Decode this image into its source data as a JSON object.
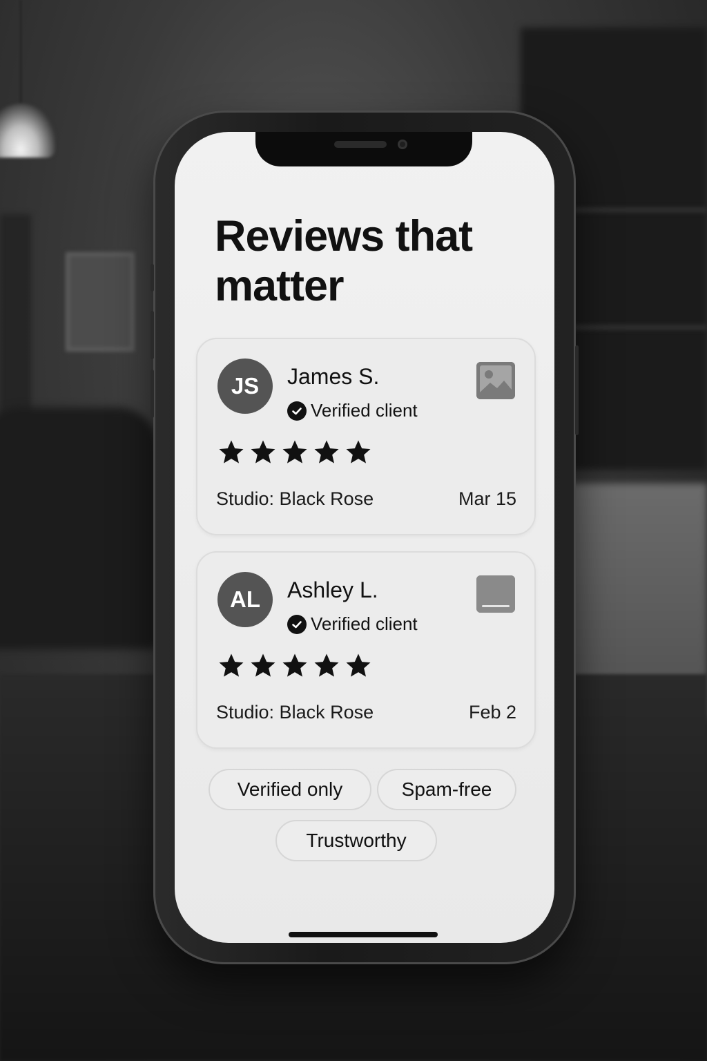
{
  "page": {
    "title": "Reviews that matter"
  },
  "reviews": [
    {
      "initials": "JS",
      "name": "James S.",
      "verified_label": "Verified client",
      "rating": 5,
      "studio": "Studio: Black Rose",
      "date": "Mar 15",
      "media_icon": "image-icon"
    },
    {
      "initials": "AL",
      "name": "Ashley L.",
      "verified_label": "Verified client",
      "rating": 5,
      "studio": "Studio: Black Rose",
      "date": "Feb 2",
      "media_icon": "media-placeholder-icon"
    }
  ],
  "chips": [
    "Verified only",
    "Spam-free",
    "Trustworthy"
  ],
  "colors": {
    "text": "#111111",
    "avatar": "#545454",
    "card": "#ececec"
  }
}
